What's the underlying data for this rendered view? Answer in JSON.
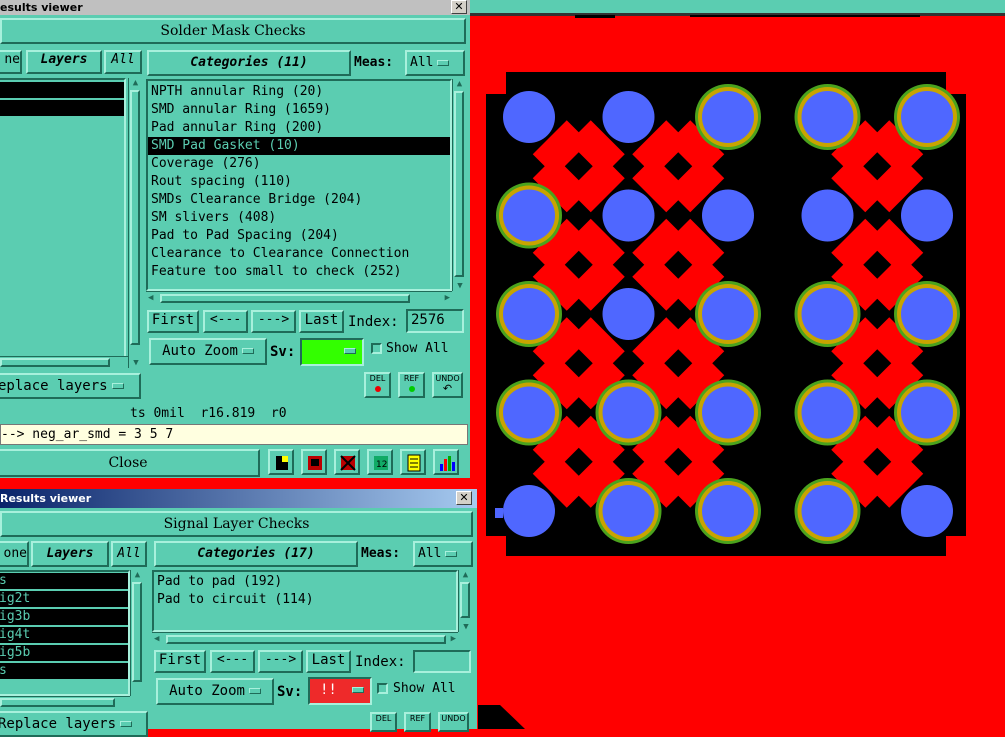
{
  "colors": {
    "canvas": "#ff0000",
    "panel": "#5bcdb1",
    "pad": "#4f67ff",
    "ring_outer": "#4ba31d",
    "ring_inner": "#c8a400",
    "mask": "#000000"
  },
  "win1": {
    "title": "esults viewer",
    "header": "Solder Mask Checks",
    "btn_none": "ne",
    "btn_layers": "Layers",
    "btn_all": "All",
    "categories_label": "Categories (11)",
    "meas_label": "Meas:",
    "meas_value": "All",
    "categories": [
      "NPTH annular Ring (20)",
      "SMD annular Ring (1659)",
      "Pad annular Ring (200)",
      "SMD Pad Gasket (10)",
      "Coverage (276)",
      "Rout spacing (110)",
      "SMDs Clearance Bridge (204)",
      "SM slivers (408)",
      "Pad to Pad Spacing (204)",
      "Clearance to Clearance Connection",
      "Feature too small to check (252)"
    ],
    "nav": {
      "first": "First",
      "prev": "<---",
      "next": "--->",
      "last": "Last",
      "index_label": "Index:",
      "index_value": "2576"
    },
    "zoom": "Auto Zoom",
    "sv_label": "Sv:",
    "show_all": "Show All",
    "replace": "eplace layers",
    "del": "DEL",
    "ref": "REF",
    "undo": "UNDO",
    "status": "ts 0mil  r16.819  r0",
    "message": "--> neg_ar_smd = 3 5 7",
    "close": "Close"
  },
  "win2": {
    "title": "Results viewer",
    "header": "Signal Layer Checks",
    "btn_none": "one",
    "btn_layers": "Layers",
    "btn_all": "All",
    "layers": [
      "s",
      "ig2t",
      "ig3b",
      "ig4t",
      "ig5b",
      "s"
    ],
    "categories_label": "Categories (17)",
    "meas_label": "Meas:",
    "meas_value": "All",
    "categories": [
      "Pad to pad (192)",
      "Pad to circuit (114)"
    ],
    "nav": {
      "first": "First",
      "prev": "<---",
      "next": "--->",
      "last": "Last",
      "index_label": "Index:",
      "index_value": ""
    },
    "zoom": "Auto Zoom",
    "sv_label": "Sv:",
    "sv_value": "!!",
    "show_all": "Show All",
    "replace": "Replace layers",
    "del": "DEL",
    "ref": "REF",
    "undo": "UNDO"
  },
  "pads": [
    {
      "row": 0,
      "col": 0,
      "ring": false
    },
    {
      "row": 0,
      "col": 1,
      "ring": false
    },
    {
      "row": 0,
      "col": 2,
      "ring": true
    },
    {
      "row": 0,
      "col": 3,
      "ring": true
    },
    {
      "row": 0,
      "col": 4,
      "ring": true
    },
    {
      "row": 1,
      "col": 0,
      "ring": true
    },
    {
      "row": 1,
      "col": 1,
      "ring": false
    },
    {
      "row": 1,
      "col": 2,
      "ring": false
    },
    {
      "row": 1,
      "col": 3,
      "ring": false
    },
    {
      "row": 1,
      "col": 4,
      "ring": false
    },
    {
      "row": 2,
      "col": 0,
      "ring": true
    },
    {
      "row": 2,
      "col": 1,
      "ring": false
    },
    {
      "row": 2,
      "col": 2,
      "ring": true
    },
    {
      "row": 2,
      "col": 3,
      "ring": true
    },
    {
      "row": 2,
      "col": 4,
      "ring": true
    },
    {
      "row": 3,
      "col": 0,
      "ring": true
    },
    {
      "row": 3,
      "col": 1,
      "ring": true
    },
    {
      "row": 3,
      "col": 2,
      "ring": true
    },
    {
      "row": 3,
      "col": 3,
      "ring": true
    },
    {
      "row": 3,
      "col": 4,
      "ring": true
    },
    {
      "row": 4,
      "col": 0,
      "ring": false
    },
    {
      "row": 4,
      "col": 1,
      "ring": true
    },
    {
      "row": 4,
      "col": 2,
      "ring": true
    },
    {
      "row": 4,
      "col": 3,
      "ring": true
    },
    {
      "row": 4,
      "col": 4,
      "ring": false
    }
  ]
}
